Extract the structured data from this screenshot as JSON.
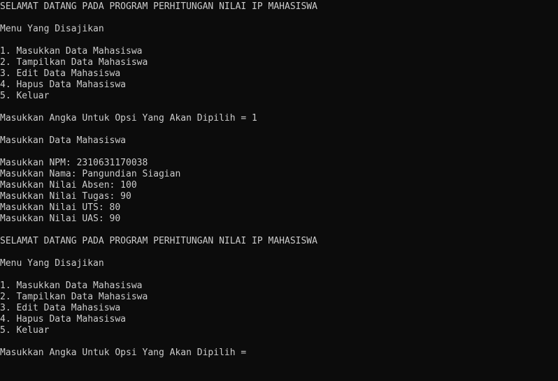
{
  "console": {
    "lines": [
      "SELAMAT DATANG PADA PROGRAM PERHITUNGAN NILAI IP MAHASISWA",
      "",
      "Menu Yang Disajikan",
      "",
      "1. Masukkan Data Mahasiswa",
      "2. Tampilkan Data Mahasiswa",
      "3. Edit Data Mahasiswa",
      "4. Hapus Data Mahasiswa",
      "5. Keluar",
      "",
      "Masukkan Angka Untuk Opsi Yang Akan Dipilih = 1",
      "",
      "Masukkan Data Mahasiswa",
      "",
      "Masukkan NPM: 2310631170038",
      "Masukkan Nama: Pangundian Siagian",
      "Masukkan Nilai Absen: 100",
      "Masukkan Nilai Tugas: 90",
      "Masukkan Nilai UTS: 80",
      "Masukkan Nilai UAS: 90",
      "",
      "SELAMAT DATANG PADA PROGRAM PERHITUNGAN NILAI IP MAHASISWA",
      "",
      "Menu Yang Disajikan",
      "",
      "1. Masukkan Data Mahasiswa",
      "2. Tampilkan Data Mahasiswa",
      "3. Edit Data Mahasiswa",
      "4. Hapus Data Mahasiswa",
      "5. Keluar",
      "",
      "Masukkan Angka Untuk Opsi Yang Akan Dipilih = "
    ]
  },
  "colors": {
    "background": "#0c0c0c",
    "text": "#cccccc"
  }
}
